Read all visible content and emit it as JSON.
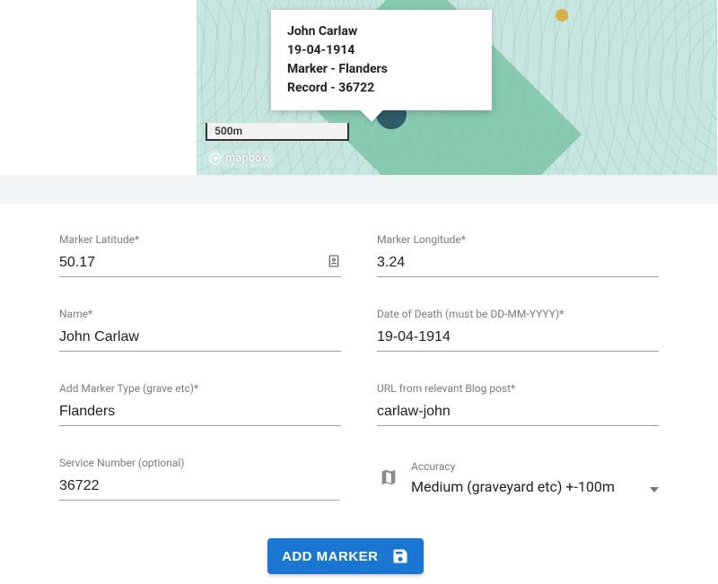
{
  "map": {
    "popup": {
      "name": "John Carlaw",
      "date": "19-04-1914",
      "marker_line": "Marker - Flanders",
      "record_line": "Record - 36722"
    },
    "scale": "500m",
    "attribution": "mapbox"
  },
  "form": {
    "lat": {
      "label": "Marker Latitude*",
      "value": "50.17"
    },
    "lng": {
      "label": "Marker Longitude*",
      "value": "3.24"
    },
    "name": {
      "label": "Name*",
      "value": "John Carlaw"
    },
    "dod": {
      "label": "Date of Death (must be DD-MM-YYYY)*",
      "value": "19-04-1914"
    },
    "marker_type": {
      "label": "Add Marker Type (grave etc)*",
      "value": "Flanders"
    },
    "url": {
      "label": "URL from relevant Blog post*",
      "value": "carlaw-john"
    },
    "service_no": {
      "label": "Service Number (optional)",
      "value": "36722"
    },
    "accuracy": {
      "label": "Accuracy",
      "value": "Medium (graveyard etc) +-100m"
    }
  },
  "button": {
    "label": "ADD MARKER"
  }
}
